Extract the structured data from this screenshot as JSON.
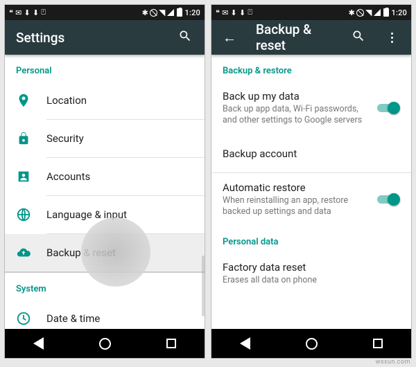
{
  "status": {
    "time": "1:20",
    "left_icons": [
      "hangouts",
      "gmail",
      "download",
      "download",
      "translate"
    ],
    "right_icons": [
      "bluetooth",
      "no-sim",
      "wifi",
      "signal",
      "battery"
    ]
  },
  "left_screen": {
    "appbar": {
      "title": "Settings"
    },
    "section_personal": "Personal",
    "items": {
      "location": "Location",
      "security": "Security",
      "accounts": "Accounts",
      "language": "Language & input",
      "backup": "Backup & reset"
    },
    "section_system": "System",
    "datetime": "Date & time"
  },
  "right_screen": {
    "appbar": {
      "title": "Backup & reset"
    },
    "section_backup": "Backup & restore",
    "backup_data": {
      "title": "Back up my data",
      "sub": "Back up app data, Wi-Fi passwords, and other settings to Google servers",
      "on": true
    },
    "backup_account": {
      "title": "Backup account"
    },
    "auto_restore": {
      "title": "Automatic restore",
      "sub": "When reinstalling an app, restore backed up settings and data",
      "on": true
    },
    "section_personal_data": "Personal data",
    "factory": {
      "title": "Factory data reset",
      "sub": "Erases all data on phone"
    }
  },
  "watermark": "wsxun.com"
}
